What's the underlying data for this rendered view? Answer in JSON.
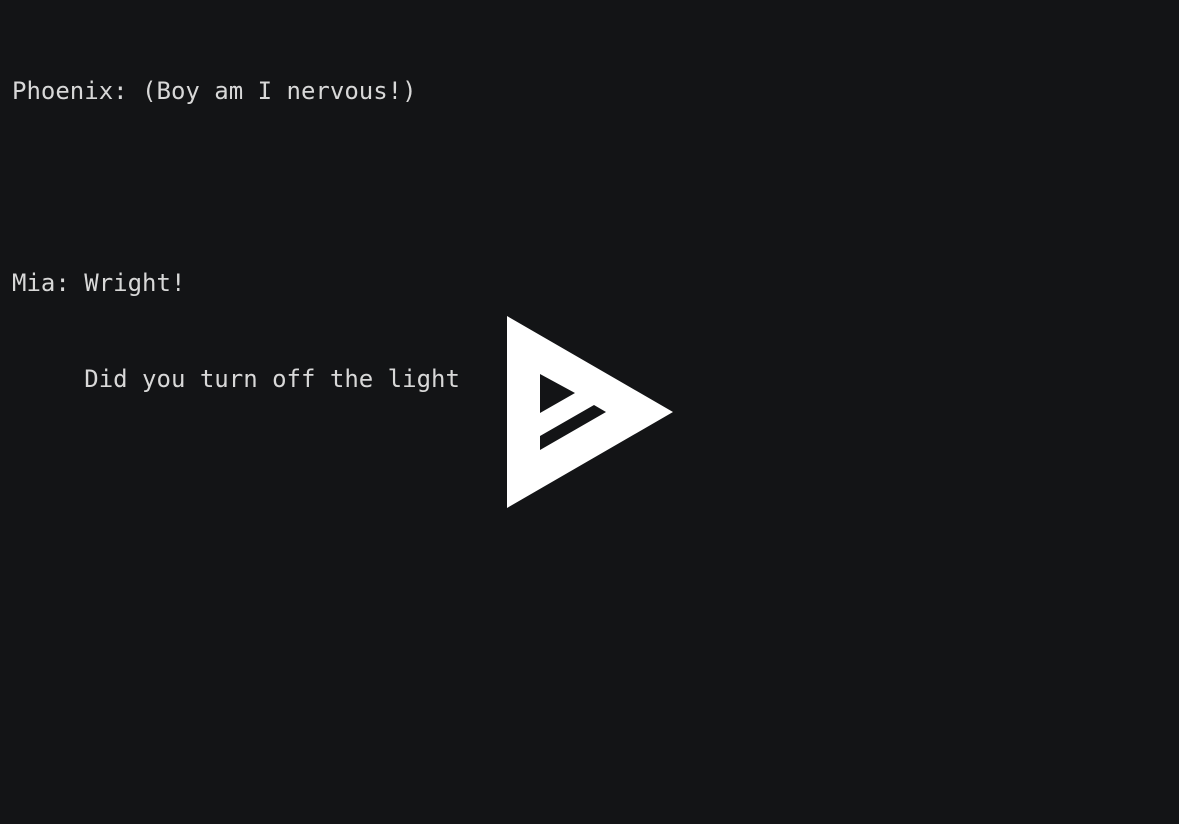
{
  "dialogue": {
    "line1": "Phoenix: (Boy am I nervous!)",
    "line2": "Mia: Wright!",
    "line3": "     Did you turn off the light"
  },
  "logo": {
    "icon": "play-logo-icon",
    "color": "#ffffff"
  },
  "colors": {
    "background": "#131416",
    "text": "#d8d8d8"
  }
}
